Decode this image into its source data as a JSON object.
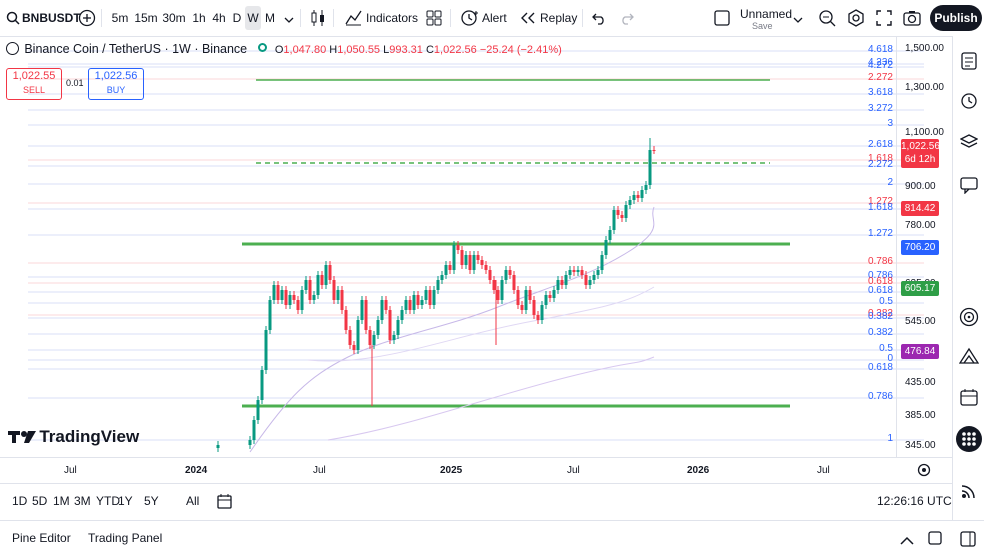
{
  "symbol": "BNBUSDT",
  "intervals": [
    "5m",
    "15m",
    "30m",
    "1h",
    "4h",
    "D",
    "W",
    "M"
  ],
  "selected_interval": "W",
  "toolbar": {
    "indicators": "Indicators",
    "alert": "Alert",
    "replay": "Replay",
    "layout_name": "Unnamed",
    "layout_save": "Save",
    "publish": "Publish"
  },
  "legend": {
    "title": "Binance Coin / TetherUS · 1W · Binance",
    "open_label": "O",
    "open": "1,047.80",
    "high_label": "H",
    "high": "1,050.55",
    "low_label": "L",
    "low": "993.31",
    "close_label": "C",
    "close": "1,022.56",
    "change": "−25.24 (−2.41%)"
  },
  "trade": {
    "sell_price": "1,022.55",
    "sell_label": "SELL",
    "spread": "0.01",
    "buy_price": "1,022.56",
    "buy_label": "BUY"
  },
  "watermark": "TradingView",
  "y_axis": [
    "1,500.00",
    "1,300.00",
    "1,100.00",
    "900.00",
    "780.00",
    "625.00",
    "545.00",
    "435.00",
    "385.00",
    "345.00"
  ],
  "fib_labels": [
    {
      "text": "4.618",
      "color": "#2962ff"
    },
    {
      "text": "4.236",
      "color": "#2962ff"
    },
    {
      "text": "4.272",
      "color": "#2962ff"
    },
    {
      "text": "2.272",
      "color": "#f23645"
    },
    {
      "text": "3.618",
      "color": "#2962ff"
    },
    {
      "text": "3.272",
      "color": "#2962ff"
    },
    {
      "text": "3",
      "color": "#2962ff"
    },
    {
      "text": "2.618",
      "color": "#2962ff"
    },
    {
      "text": "1.618",
      "color": "#f23645"
    },
    {
      "text": "2.272",
      "color": "#2962ff"
    },
    {
      "text": "2",
      "color": "#2962ff"
    },
    {
      "text": "1.272",
      "color": "#f23645"
    },
    {
      "text": "1.618",
      "color": "#2962ff"
    },
    {
      "text": "1.272",
      "color": "#2962ff"
    },
    {
      "text": "0.786",
      "color": "#f23645"
    },
    {
      "text": "0.786",
      "color": "#2962ff"
    },
    {
      "text": "0.618",
      "color": "#f23645"
    },
    {
      "text": "0.618",
      "color": "#2962ff"
    },
    {
      "text": "0.5",
      "color": "#2962ff"
    },
    {
      "text": "0.382",
      "color": "#f23645"
    },
    {
      "text": "0.382",
      "color": "#2962ff"
    },
    {
      "text": "0.382",
      "color": "#2962ff"
    },
    {
      "text": "0.5",
      "color": "#2962ff"
    },
    {
      "text": "0",
      "color": "#2962ff"
    },
    {
      "text": "0.618",
      "color": "#2962ff"
    },
    {
      "text": "0.786",
      "color": "#2962ff"
    },
    {
      "text": "1",
      "color": "#2962ff"
    }
  ],
  "price_tags": [
    {
      "text": "1,022.56",
      "sub": "6d 12h",
      "color": "#f23645"
    },
    {
      "text": "814.42",
      "color": "#f23645"
    },
    {
      "text": "706.20",
      "color": "#2962ff"
    },
    {
      "text": "605.17",
      "color": "#2e9e47"
    },
    {
      "text": "476.84",
      "color": "#9c27b0"
    }
  ],
  "x_axis": [
    "Jul",
    "2024",
    "Jul",
    "2025",
    "Jul",
    "2026",
    "Jul"
  ],
  "x_axis_bold": [
    "2024",
    "2025",
    "2026"
  ],
  "ranges": [
    "1D",
    "5D",
    "1M",
    "3M",
    "YTD",
    "1Y",
    "5Y",
    "All"
  ],
  "clock": "12:26:16 UTC",
  "footer": {
    "pine_editor": "Pine Editor",
    "trading_panel": "Trading Panel"
  },
  "colors": {
    "up": "#089981",
    "down": "#f23645",
    "level": "#4caf50",
    "accent": "#2962ff"
  },
  "chart_data": {
    "type": "candlestick",
    "y_scale": "log",
    "ylim": [
      330,
      1600
    ],
    "horizontal_levels": [
      1370,
      900,
      706,
      398
    ],
    "candles": []
  }
}
